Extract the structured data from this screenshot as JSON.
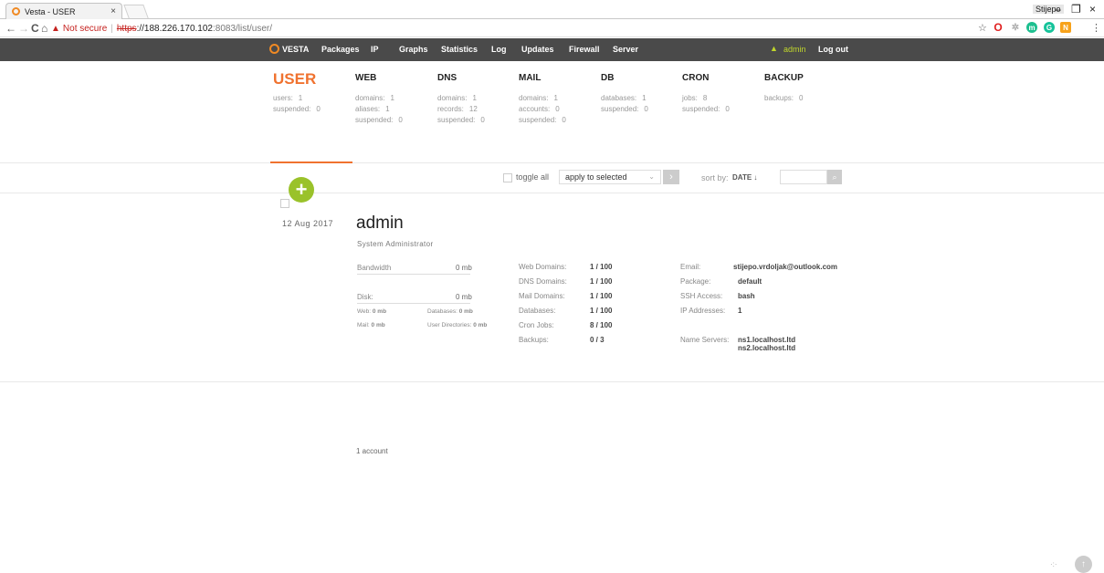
{
  "browser": {
    "tab_title": "Vesta - USER",
    "tab_close": "×",
    "profile": "Stijepo",
    "win_minimize": "–",
    "win_restore": "❐",
    "win_close": "×",
    "back": "←",
    "forward": "→",
    "reload": "C",
    "home": "⌂",
    "warning": "▲",
    "not_secure": "Not secure",
    "divider": "|",
    "url_scheme": "https",
    "url_host": "://188.226.170.102",
    "url_path": ":8083/list/user/",
    "star": "☆",
    "menu": "⋮"
  },
  "nav": {
    "logo": "VESTA",
    "items": [
      "Packages",
      "IP",
      "Graphs",
      "Statistics",
      "Log",
      "Updates",
      "Firewall",
      "Server"
    ],
    "bell": "▲",
    "user": "admin",
    "logout": "Log out"
  },
  "stats": [
    {
      "title": "USER",
      "lines": [
        {
          "k": "users:",
          "v": "1"
        },
        {
          "k": "suspended:",
          "v": "0"
        }
      ]
    },
    {
      "title": "WEB",
      "lines": [
        {
          "k": "domains:",
          "v": "1"
        },
        {
          "k": "aliases:",
          "v": "1"
        },
        {
          "k": "suspended:",
          "v": "0"
        }
      ]
    },
    {
      "title": "DNS",
      "lines": [
        {
          "k": "domains:",
          "v": "1"
        },
        {
          "k": "records:",
          "v": "12"
        },
        {
          "k": "suspended:",
          "v": "0"
        }
      ]
    },
    {
      "title": "MAIL",
      "lines": [
        {
          "k": "domains:",
          "v": "1"
        },
        {
          "k": "accounts:",
          "v": "0"
        },
        {
          "k": "suspended:",
          "v": "0"
        }
      ]
    },
    {
      "title": "DB",
      "lines": [
        {
          "k": "databases:",
          "v": "1"
        },
        {
          "k": "suspended:",
          "v": "0"
        }
      ]
    },
    {
      "title": "CRON",
      "lines": [
        {
          "k": "jobs:",
          "v": "8"
        },
        {
          "k": "suspended:",
          "v": "0"
        }
      ]
    },
    {
      "title": "BACKUP",
      "lines": [
        {
          "k": "backups:",
          "v": "0"
        }
      ]
    }
  ],
  "controls": {
    "toggle_all": "toggle all",
    "apply_select": "apply to selected",
    "select_arrow": "⌄",
    "apply_arrow": "›",
    "sort_by": "sort by:",
    "sort_value": "DATE ↓",
    "search_glyph": "⌕",
    "add_glyph": "+"
  },
  "user_row": {
    "date": "12 Aug 2017",
    "name": "admin",
    "role": "System Administrator",
    "bandwidth_label": "Bandwidth",
    "bandwidth_value": "0 mb",
    "disk_label": "Disk:",
    "disk_value": "0 mb",
    "web_label": "Web:",
    "web_value": "0 mb",
    "databases_label": "Databases:",
    "databases_value": "0 mb",
    "mail_label": "Mail:",
    "mail_value": "0 mb",
    "userdirs_label": "User Directories:",
    "userdirs_value": "0 mb",
    "limits": [
      {
        "k": "Web Domains:",
        "v": "1 / 100"
      },
      {
        "k": "DNS Domains:",
        "v": "1 / 100"
      },
      {
        "k": "Mail Domains:",
        "v": "1 / 100"
      },
      {
        "k": "Databases:",
        "v": "1 / 100"
      },
      {
        "k": "Cron Jobs:",
        "v": "8 / 100"
      },
      {
        "k": "Backups:",
        "v": "0 / 3"
      }
    ],
    "email_label": "Email:",
    "email_value": "stijepo.vrdoljak@outlook.com",
    "package_label": "Package:",
    "package_value": "default",
    "ssh_label": "SSH Access:",
    "ssh_value": "bash",
    "ip_label": "IP Addresses:",
    "ip_value": "1",
    "ns_label": "Name Servers:",
    "ns1": "ns1.localhost.ltd",
    "ns2": "ns2.localhost.ltd"
  },
  "footer": {
    "count": "1 account",
    "dots": "·:·",
    "scroll_top": "↑"
  }
}
